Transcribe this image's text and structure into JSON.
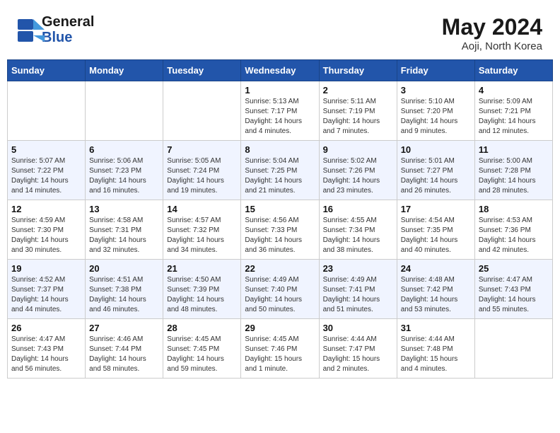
{
  "header": {
    "logo_general": "General",
    "logo_blue": "Blue",
    "month_year": "May 2024",
    "location": "Aoji, North Korea"
  },
  "days_of_week": [
    "Sunday",
    "Monday",
    "Tuesday",
    "Wednesday",
    "Thursday",
    "Friday",
    "Saturday"
  ],
  "weeks": [
    [
      {
        "date": "",
        "info": ""
      },
      {
        "date": "",
        "info": ""
      },
      {
        "date": "",
        "info": ""
      },
      {
        "date": "1",
        "info": "Sunrise: 5:13 AM\nSunset: 7:17 PM\nDaylight: 14 hours\nand 4 minutes."
      },
      {
        "date": "2",
        "info": "Sunrise: 5:11 AM\nSunset: 7:19 PM\nDaylight: 14 hours\nand 7 minutes."
      },
      {
        "date": "3",
        "info": "Sunrise: 5:10 AM\nSunset: 7:20 PM\nDaylight: 14 hours\nand 9 minutes."
      },
      {
        "date": "4",
        "info": "Sunrise: 5:09 AM\nSunset: 7:21 PM\nDaylight: 14 hours\nand 12 minutes."
      }
    ],
    [
      {
        "date": "5",
        "info": "Sunrise: 5:07 AM\nSunset: 7:22 PM\nDaylight: 14 hours\nand 14 minutes."
      },
      {
        "date": "6",
        "info": "Sunrise: 5:06 AM\nSunset: 7:23 PM\nDaylight: 14 hours\nand 16 minutes."
      },
      {
        "date": "7",
        "info": "Sunrise: 5:05 AM\nSunset: 7:24 PM\nDaylight: 14 hours\nand 19 minutes."
      },
      {
        "date": "8",
        "info": "Sunrise: 5:04 AM\nSunset: 7:25 PM\nDaylight: 14 hours\nand 21 minutes."
      },
      {
        "date": "9",
        "info": "Sunrise: 5:02 AM\nSunset: 7:26 PM\nDaylight: 14 hours\nand 23 minutes."
      },
      {
        "date": "10",
        "info": "Sunrise: 5:01 AM\nSunset: 7:27 PM\nDaylight: 14 hours\nand 26 minutes."
      },
      {
        "date": "11",
        "info": "Sunrise: 5:00 AM\nSunset: 7:28 PM\nDaylight: 14 hours\nand 28 minutes."
      }
    ],
    [
      {
        "date": "12",
        "info": "Sunrise: 4:59 AM\nSunset: 7:30 PM\nDaylight: 14 hours\nand 30 minutes."
      },
      {
        "date": "13",
        "info": "Sunrise: 4:58 AM\nSunset: 7:31 PM\nDaylight: 14 hours\nand 32 minutes."
      },
      {
        "date": "14",
        "info": "Sunrise: 4:57 AM\nSunset: 7:32 PM\nDaylight: 14 hours\nand 34 minutes."
      },
      {
        "date": "15",
        "info": "Sunrise: 4:56 AM\nSunset: 7:33 PM\nDaylight: 14 hours\nand 36 minutes."
      },
      {
        "date": "16",
        "info": "Sunrise: 4:55 AM\nSunset: 7:34 PM\nDaylight: 14 hours\nand 38 minutes."
      },
      {
        "date": "17",
        "info": "Sunrise: 4:54 AM\nSunset: 7:35 PM\nDaylight: 14 hours\nand 40 minutes."
      },
      {
        "date": "18",
        "info": "Sunrise: 4:53 AM\nSunset: 7:36 PM\nDaylight: 14 hours\nand 42 minutes."
      }
    ],
    [
      {
        "date": "19",
        "info": "Sunrise: 4:52 AM\nSunset: 7:37 PM\nDaylight: 14 hours\nand 44 minutes."
      },
      {
        "date": "20",
        "info": "Sunrise: 4:51 AM\nSunset: 7:38 PM\nDaylight: 14 hours\nand 46 minutes."
      },
      {
        "date": "21",
        "info": "Sunrise: 4:50 AM\nSunset: 7:39 PM\nDaylight: 14 hours\nand 48 minutes."
      },
      {
        "date": "22",
        "info": "Sunrise: 4:49 AM\nSunset: 7:40 PM\nDaylight: 14 hours\nand 50 minutes."
      },
      {
        "date": "23",
        "info": "Sunrise: 4:49 AM\nSunset: 7:41 PM\nDaylight: 14 hours\nand 51 minutes."
      },
      {
        "date": "24",
        "info": "Sunrise: 4:48 AM\nSunset: 7:42 PM\nDaylight: 14 hours\nand 53 minutes."
      },
      {
        "date": "25",
        "info": "Sunrise: 4:47 AM\nSunset: 7:43 PM\nDaylight: 14 hours\nand 55 minutes."
      }
    ],
    [
      {
        "date": "26",
        "info": "Sunrise: 4:47 AM\nSunset: 7:43 PM\nDaylight: 14 hours\nand 56 minutes."
      },
      {
        "date": "27",
        "info": "Sunrise: 4:46 AM\nSunset: 7:44 PM\nDaylight: 14 hours\nand 58 minutes."
      },
      {
        "date": "28",
        "info": "Sunrise: 4:45 AM\nSunset: 7:45 PM\nDaylight: 14 hours\nand 59 minutes."
      },
      {
        "date": "29",
        "info": "Sunrise: 4:45 AM\nSunset: 7:46 PM\nDaylight: 15 hours\nand 1 minute."
      },
      {
        "date": "30",
        "info": "Sunrise: 4:44 AM\nSunset: 7:47 PM\nDaylight: 15 hours\nand 2 minutes."
      },
      {
        "date": "31",
        "info": "Sunrise: 4:44 AM\nSunset: 7:48 PM\nDaylight: 15 hours\nand 4 minutes."
      },
      {
        "date": "",
        "info": ""
      }
    ]
  ]
}
